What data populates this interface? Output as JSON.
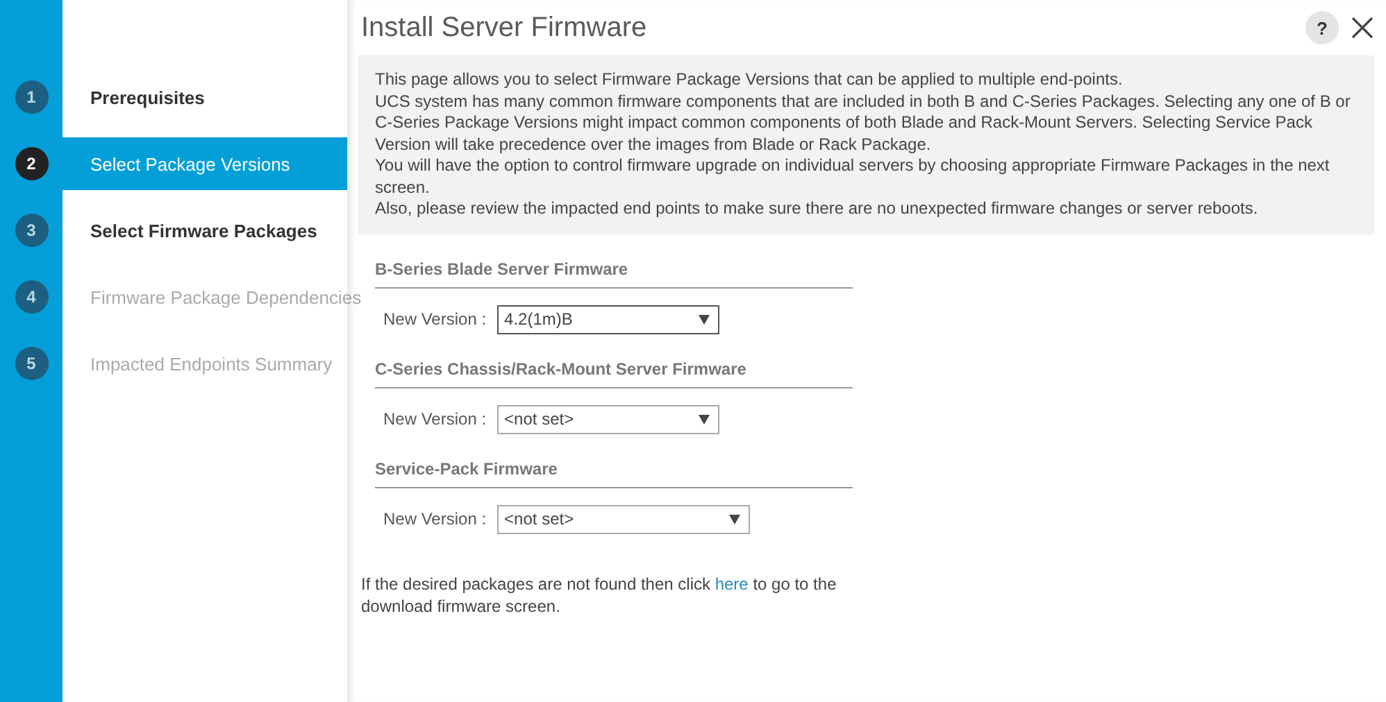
{
  "steps": [
    {
      "number": "1",
      "label": "Prerequisites",
      "selected": false,
      "disabled": false
    },
    {
      "number": "2",
      "label": "Select Package Versions",
      "selected": true,
      "disabled": false
    },
    {
      "number": "3",
      "label": "Select Firmware Packages",
      "selected": false,
      "disabled": false
    },
    {
      "number": "4",
      "label": "Firmware Package Dependencies",
      "selected": false,
      "disabled": true
    },
    {
      "number": "5",
      "label": "Impacted Endpoints Summary",
      "selected": false,
      "disabled": true
    }
  ],
  "title": "Install Server Firmware",
  "help_button": "?",
  "info_lines": [
    "This page allows you to select Firmware Package Versions that can be applied to multiple end-points.",
    "UCS system has many common firmware components that are included in both B and C-Series Packages. Selecting any one of B or C-Series Package Versions might impact common components of both Blade and Rack-Mount Servers. Selecting Service Pack Version will take precedence over the images from Blade or Rack Package.",
    "You will have the option to control firmware upgrade on individual servers by choosing appropriate Firmware Packages in the next screen.",
    "Also, please review the impacted end points to make sure there are no unexpected firmware changes or server reboots."
  ],
  "sections": [
    {
      "heading": "B-Series Blade Server Firmware",
      "label": "New Version :",
      "value": "4.2(1m)B",
      "focused": true,
      "wide": false
    },
    {
      "heading": "C-Series Chassis/Rack-Mount Server Firmware",
      "label": "New Version :",
      "value": "<not set>",
      "focused": false,
      "wide": false
    },
    {
      "heading": "Service-Pack Firmware",
      "label": "New Version :",
      "value": "<not set>",
      "focused": false,
      "wide": true
    }
  ],
  "footer": {
    "before": "If the desired packages are not found then click ",
    "link": "here",
    "after": " to go to the download firmware screen."
  }
}
